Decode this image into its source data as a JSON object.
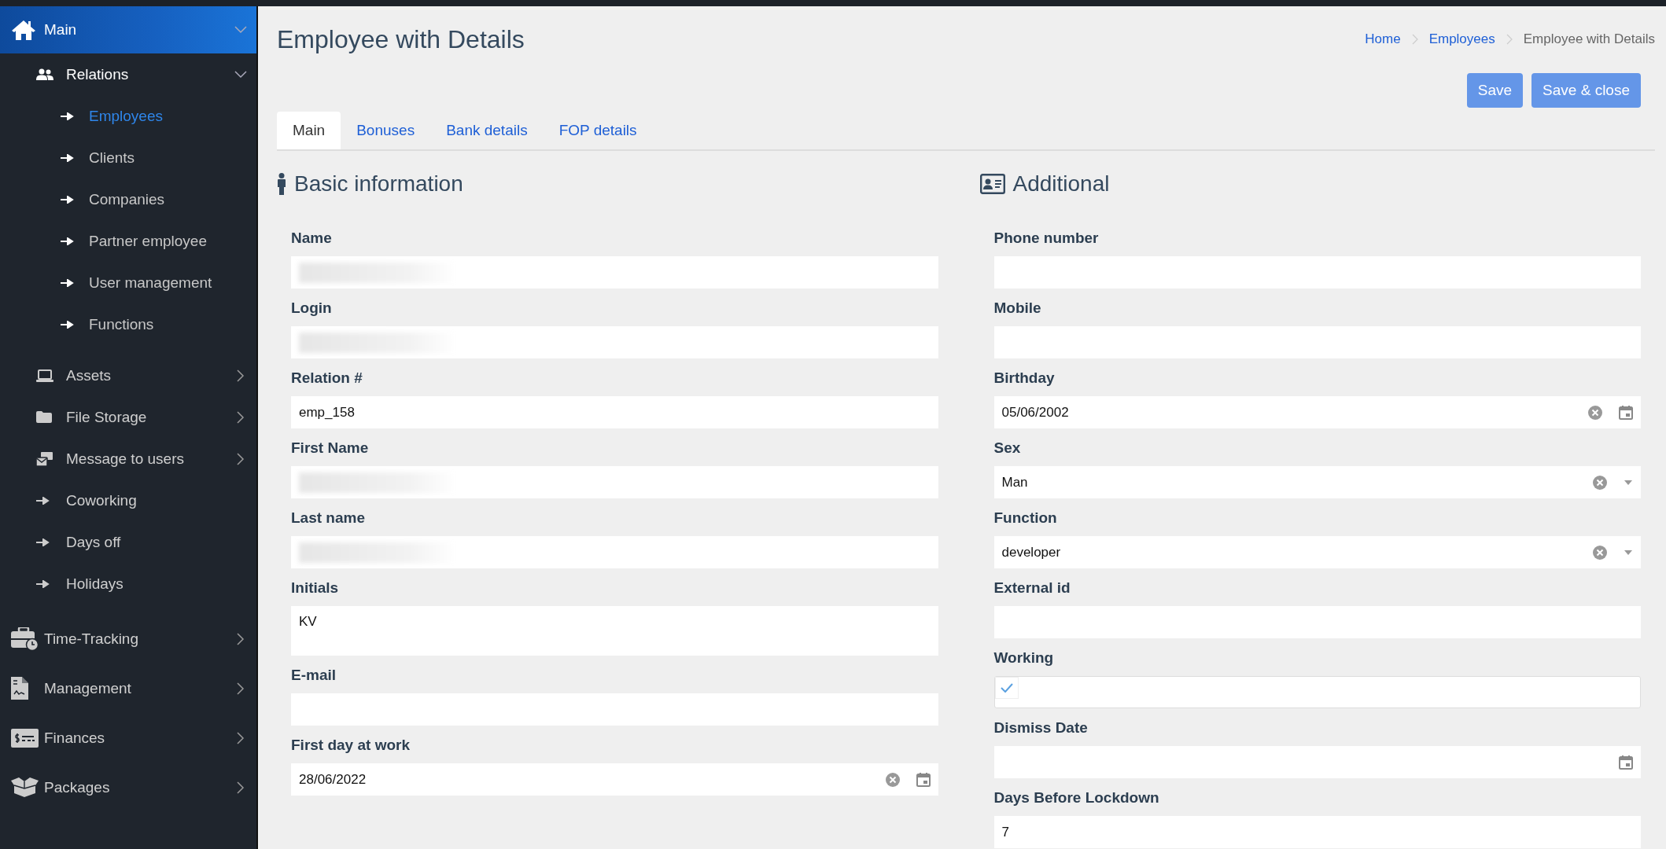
{
  "sidebar": {
    "items": [
      {
        "label": "Main",
        "kind": "group",
        "selected": true,
        "expanded": true,
        "children": [
          {
            "label": "Relations",
            "kind": "group",
            "selected": false,
            "expanded": true,
            "children": [
              {
                "label": "Employees",
                "kind": "link",
                "selected": true
              },
              {
                "label": "Clients",
                "kind": "link",
                "selected": false
              },
              {
                "label": "Companies",
                "kind": "link",
                "selected": false
              },
              {
                "label": "Partner employee",
                "kind": "link",
                "selected": false
              },
              {
                "label": "User management",
                "kind": "link",
                "selected": false
              },
              {
                "label": "Functions",
                "kind": "link",
                "selected": false
              }
            ]
          },
          {
            "label": "Assets",
            "kind": "group",
            "selected": false,
            "expanded": false
          },
          {
            "label": "File Storage",
            "kind": "group",
            "selected": false,
            "expanded": false
          },
          {
            "label": "Message to users",
            "kind": "group",
            "selected": false,
            "expanded": false
          },
          {
            "label": "Coworking",
            "kind": "link",
            "selected": false
          },
          {
            "label": "Days off",
            "kind": "link",
            "selected": false
          },
          {
            "label": "Holidays",
            "kind": "link",
            "selected": false
          }
        ]
      },
      {
        "label": "Time-Tracking",
        "kind": "group",
        "selected": false,
        "expanded": false
      },
      {
        "label": "Management",
        "kind": "group",
        "selected": false,
        "expanded": false
      },
      {
        "label": "Finances",
        "kind": "group",
        "selected": false,
        "expanded": false
      },
      {
        "label": "Packages",
        "kind": "group",
        "selected": false,
        "expanded": false
      }
    ]
  },
  "page": {
    "title": "Employee with Details",
    "breadcrumb": [
      {
        "label": "Home",
        "kind": "link"
      },
      {
        "label": "Employees",
        "kind": "link"
      },
      {
        "label": "Employee with Details",
        "kind": "current"
      }
    ],
    "buttons": [
      "Save",
      "Save & close"
    ]
  },
  "tabs": [
    {
      "label": "Main",
      "selected": true
    },
    {
      "label": "Bonuses",
      "selected": false
    },
    {
      "label": "Bank details",
      "selected": false
    },
    {
      "label": "FOP details",
      "selected": false
    }
  ],
  "sections": [
    {
      "title": "Basic information",
      "fields": [
        {
          "label": "Name",
          "kind": "text",
          "redacted": true
        },
        {
          "label": "Login",
          "kind": "text",
          "redacted": true
        },
        {
          "label": "Relation #",
          "kind": "text",
          "value": "emp_158"
        },
        {
          "label": "First Name",
          "kind": "text",
          "redacted": true
        },
        {
          "label": "Last name",
          "kind": "text",
          "redacted": true
        },
        {
          "label": "Initials",
          "kind": "textarea",
          "value": "KV"
        },
        {
          "label": "E-mail",
          "kind": "text"
        },
        {
          "label": "First day at work",
          "kind": "date",
          "value": "28/06/2022"
        }
      ]
    },
    {
      "title": "Additional",
      "fields": [
        {
          "label": "Phone number",
          "kind": "text"
        },
        {
          "label": "Mobile",
          "kind": "text"
        },
        {
          "label": "Birthday",
          "kind": "date",
          "value": "05/06/2002"
        },
        {
          "label": "Sex",
          "kind": "select",
          "value": "Man"
        },
        {
          "label": "Function",
          "kind": "select",
          "value": "developer"
        },
        {
          "label": "External id",
          "kind": "text"
        },
        {
          "label": "Working",
          "kind": "checkbox",
          "checked": true
        },
        {
          "label": "Dismiss Date",
          "kind": "date"
        },
        {
          "label": "Days Before Lockdown",
          "kind": "text",
          "value": "7"
        }
      ]
    }
  ]
}
